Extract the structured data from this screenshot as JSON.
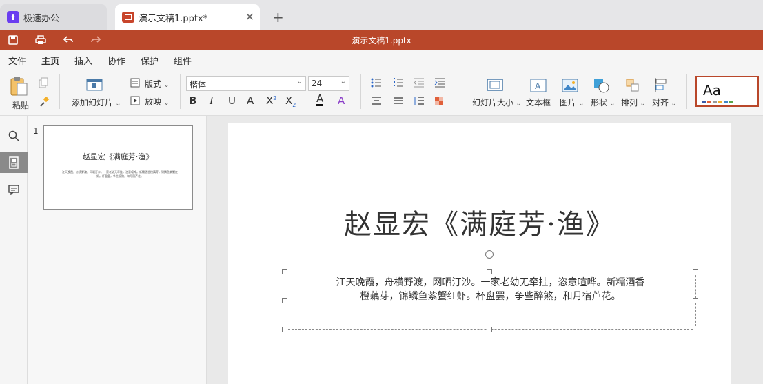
{
  "tabs": [
    {
      "label": "极速办公",
      "active": false
    },
    {
      "label": "演示文稿1.pptx*",
      "active": true
    }
  ],
  "titlebar": {
    "title": "演示文稿1.pptx"
  },
  "menu": [
    "文件",
    "主页",
    "插入",
    "协作",
    "保护",
    "组件"
  ],
  "menu_active": "主页",
  "ribbon": {
    "paste": "粘贴",
    "add_slide": "添加幻灯片",
    "layout": "版式",
    "play": "放映",
    "font_name": "楷体",
    "font_size": "24",
    "slide_size": "幻灯片大小",
    "textbox": "文本框",
    "picture": "图片",
    "shape": "形状",
    "arrange": "排列",
    "align": "对齐",
    "theme_preview": "Aa"
  },
  "thumbnails": [
    {
      "number": "1",
      "title": "赵显宏《满庭芳·渔》",
      "body": "江天晚霞，舟横野渡，网晒汀沙。一家老幼无牵挂，恣意喧哗。新糯酒香橙藕芽，锦鳞鱼紫蟹红虾。杯盘罢，争些醉煞，和月宿芦花。"
    }
  ],
  "slide": {
    "title": "赵显宏《满庭芳·渔》",
    "body_line1": "江天晚霞，舟横野渡，网晒汀沙。一家老幼无牵挂，恣意喧哗。新糯酒香",
    "body_line2": "橙藕芽，锦鳞鱼紫蟹红虾。杯盘罢，争些醉煞，和月宿芦花。"
  },
  "colors": {
    "accent": "#b9472a",
    "tab_icon": "#6a3df0"
  }
}
